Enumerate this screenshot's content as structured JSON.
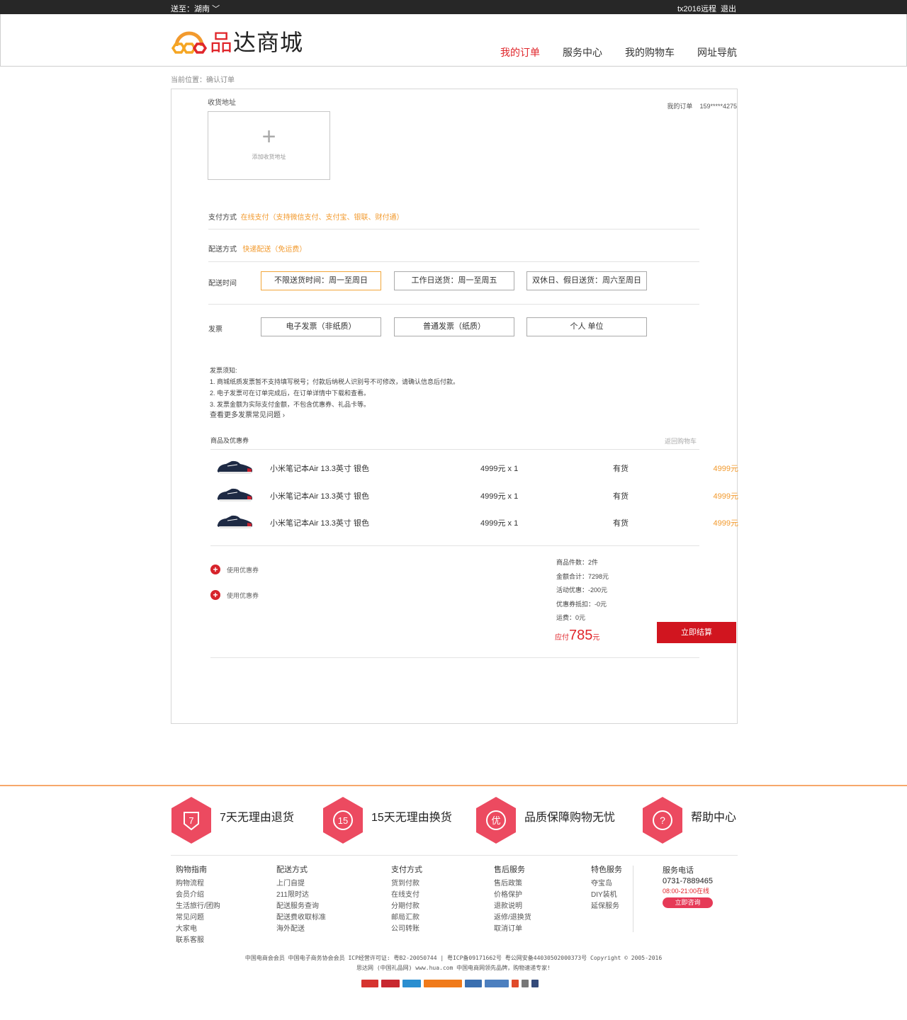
{
  "topbar": {
    "deliver_to": "送至：湖南",
    "user": "tx2016远程",
    "logout": "退出"
  },
  "header": {
    "logo_text_red": "品",
    "logo_text_dark": "达商城",
    "nav": [
      "我的订单",
      "服务中心",
      "我的购物车",
      "网址导航"
    ]
  },
  "breadcrumb": "当前位置：确认订单",
  "address": {
    "label": "收货地址",
    "plus": "+",
    "add_text": "添加收货地址",
    "my_orders": "我的订单",
    "phone": "159*****4275"
  },
  "payment": {
    "label": "支付方式",
    "value": "在线支付（支持微信支付、支付宝、银联、财付通）"
  },
  "delivery": {
    "label": "配送方式",
    "value": "快递配送（免运费）"
  },
  "delivery_time": {
    "label": "配送时间",
    "options": [
      "不限送货时间：周一至周日",
      "工作日送货：周一至周五",
      "双休日、假日送货：周六至周日"
    ]
  },
  "invoice": {
    "label": "发票",
    "options": [
      "电子发票（非纸质）",
      "普通发票（纸质）",
      "个人 单位"
    ]
  },
  "invoice_notes": {
    "title": "发票须知:",
    "items": [
      "1. 商城纸质发票暂不支持填写税号；付款后纳税人识别号不可修改，请确认信息后付款。",
      "2. 电子发票可在订单完成后，在订单详情中下载和查看。",
      "3. 发票金额为实际支付金额，不包含优惠券、礼品卡等。"
    ],
    "more": "查看更多发票常见问题 ›"
  },
  "goods": {
    "title": "商品及优惠券",
    "back_to_cart": "返回购物车",
    "items": [
      {
        "name": "小米笔记本Air 13.3英寸 银色",
        "price": "4999元 x 1",
        "stock": "有货",
        "total": "4999元"
      },
      {
        "name": "小米笔记本Air 13.3英寸 银色",
        "price": "4999元 x 1",
        "stock": "有货",
        "total": "4999元"
      },
      {
        "name": "小米笔记本Air 13.3英寸 银色",
        "price": "4999元 x 1",
        "stock": "有货",
        "total": "4999元"
      }
    ]
  },
  "coupons": [
    "使用优惠券",
    "使用优惠券"
  ],
  "summary": {
    "lines": [
      "商品件数：2件",
      "金额合计：7298元",
      "活动优惠：-200元",
      "优惠券抵扣：-0元",
      "运费：0元"
    ],
    "pay_label": "应付",
    "pay_amount": "785",
    "pay_unit": "元",
    "checkout": "立即结算"
  },
  "features": [
    {
      "icon_text": "7",
      "text": "7天无理由退货"
    },
    {
      "icon_text": "15",
      "text": "15天无理由换货"
    },
    {
      "icon_text": "优",
      "text": "品质保障购物无忧"
    },
    {
      "icon_text": "?",
      "text": "帮助中心"
    }
  ],
  "footer_columns": [
    {
      "title": "购物指南",
      "links": [
        "购物流程",
        "会员介绍",
        "生活旅行/团购",
        "常见问题",
        "大家电",
        "联系客服"
      ]
    },
    {
      "title": "配送方式",
      "links": [
        "上门自提",
        "211限时达",
        "配送服务查询",
        "配送费收取标准",
        "海外配送"
      ]
    },
    {
      "title": "支付方式",
      "links": [
        "货到付款",
        "在线支付",
        "分期付款",
        "邮局汇款",
        "公司转账"
      ]
    },
    {
      "title": "售后服务",
      "links": [
        "售后政策",
        "价格保护",
        "退款说明",
        "返修/退换货",
        "取消订单"
      ]
    },
    {
      "title": "特色服务",
      "links": [
        "夺宝岛",
        "DIY装机",
        "延保服务"
      ]
    }
  ],
  "service": {
    "title": "服务电话",
    "phone": "0731-7889465",
    "hours": "08:00-21:00在线",
    "consult": "立即咨询"
  },
  "copyright": {
    "line1": "中国电商会会员 中国电子商务协会会员 ICP经营许可证: 粤B2-20050744 | 粤ICP备09171662号 粤公网安备44030502000373号 Copyright © 2005-2016",
    "line2": "思达网 (中国礼品网) www.hua.com 中国电商网领先品牌，购物速递专家!"
  },
  "colors": {
    "brand_red": "#e0262b",
    "accent_orange": "#f29a2e",
    "checkout_red": "#d1151f",
    "feature_pink": "#ec4a60"
  }
}
